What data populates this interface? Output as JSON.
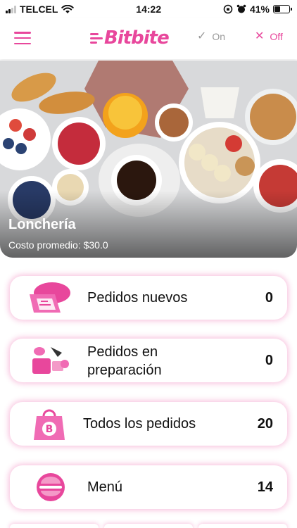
{
  "status_bar": {
    "carrier": "TELCEL",
    "time": "14:22",
    "battery": "41%",
    "battery_level": 0.41
  },
  "header": {
    "logo_text": "Bitbite",
    "toggle_on": {
      "label": "On",
      "icon": "check-icon"
    },
    "toggle_off": {
      "label": "Off",
      "icon": "close-icon"
    },
    "accent_color": "#e8479c"
  },
  "hero": {
    "title": "Lonchería",
    "subtitle": "Costo promedio: $30.0"
  },
  "cards": [
    {
      "label": "Pedidos nuevos",
      "count": "0",
      "icon": "new-orders-icon"
    },
    {
      "label": "Pedidos en preparación",
      "count": "0",
      "icon": "cooking-icon"
    },
    {
      "label": "Todos los pedidos",
      "count": "20",
      "icon": "shopping-bag-icon"
    },
    {
      "label": "Menú",
      "count": "14",
      "icon": "menu-burger-icon"
    }
  ]
}
